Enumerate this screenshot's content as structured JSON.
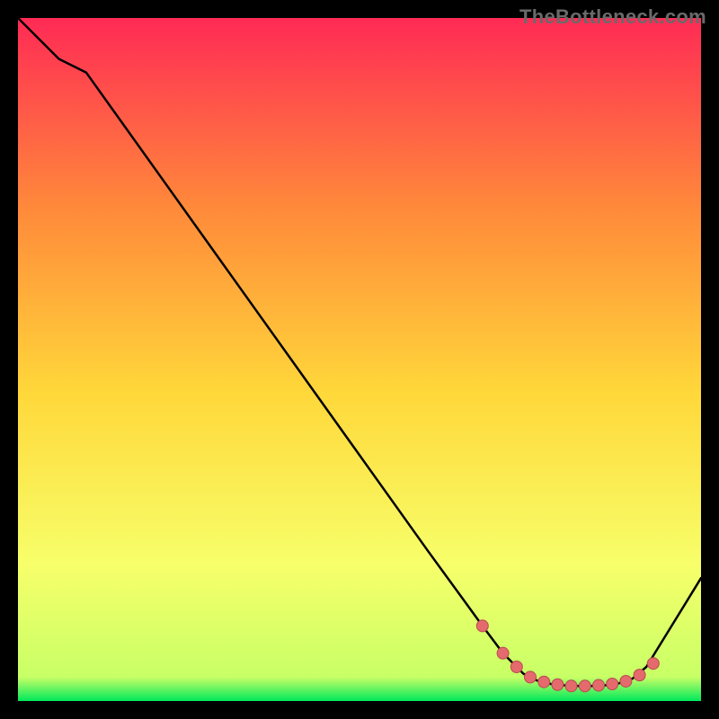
{
  "watermark": "TheBottleneck.com",
  "colors": {
    "black": "#000000",
    "line": "#000000",
    "marker_fill": "#e46a6d",
    "marker_stroke": "#b94a4e",
    "grad_top": "#ff2a55",
    "grad_mid1": "#ff8a3a",
    "grad_mid2": "#ffd83a",
    "grad_mid3": "#f7ff6a",
    "grad_bottom": "#00e95c"
  },
  "chart_data": {
    "type": "line",
    "title": "",
    "xlabel": "",
    "ylabel": "",
    "xlim": [
      0,
      100
    ],
    "ylim": [
      0,
      100
    ],
    "series": [
      {
        "name": "curve",
        "x": [
          0,
          6,
          10,
          20,
          30,
          40,
          50,
          60,
          68,
          71,
          74,
          76,
          78,
          80,
          82,
          84,
          86,
          88,
          90,
          92,
          100
        ],
        "y": [
          100,
          94,
          92,
          78,
          64,
          50,
          36,
          22,
          11,
          7,
          4,
          3,
          2.5,
          2.3,
          2.2,
          2.2,
          2.3,
          2.6,
          3.3,
          5,
          18
        ]
      }
    ],
    "markers": {
      "name": "flat-region-dots",
      "x": [
        68,
        71,
        73,
        75,
        77,
        79,
        81,
        83,
        85,
        87,
        89,
        91,
        93
      ],
      "y": [
        11,
        7,
        5,
        3.5,
        2.8,
        2.4,
        2.2,
        2.2,
        2.3,
        2.5,
        2.9,
        3.8,
        5.5
      ]
    },
    "background_gradient": {
      "stops": [
        {
          "offset": 0.0,
          "color": "#ff2a55"
        },
        {
          "offset": 0.28,
          "color": "#ff8a3a"
        },
        {
          "offset": 0.55,
          "color": "#ffd83a"
        },
        {
          "offset": 0.8,
          "color": "#f7ff6a"
        },
        {
          "offset": 0.965,
          "color": "#c8ff66"
        },
        {
          "offset": 1.0,
          "color": "#00e95c"
        }
      ]
    }
  }
}
